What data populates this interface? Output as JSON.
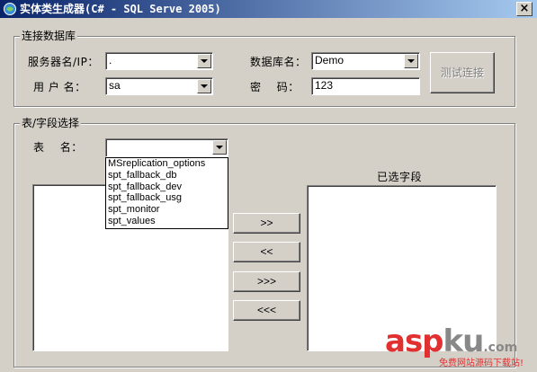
{
  "window": {
    "title": "实体类生成器(C# - SQL Serve 2005)",
    "close_glyph": "×"
  },
  "connect_group": {
    "title": "连接数据库",
    "server_label": "服务器名/IP：",
    "server_value": ".",
    "database_label": "数据库名：",
    "database_value": "Demo",
    "user_label": "用 户 名：",
    "user_value": "sa",
    "password_label": "密    码：",
    "password_value": "123",
    "test_button": "测试连接"
  },
  "select_group": {
    "title": "表/字段选择",
    "table_label": "表    名：",
    "table_value": "",
    "table_options": [
      "MSreplication_options",
      "spt_fallback_db",
      "spt_fallback_dev",
      "spt_fallback_usg",
      "spt_monitor",
      "spt_values"
    ],
    "selected_fields_label": "已选字段",
    "btn_add": ">>",
    "btn_remove": "<<",
    "btn_add_all": ">>>",
    "btn_remove_all": "<<<"
  },
  "watermark": {
    "brand_part1": "asp",
    "brand_part2": "ku",
    "brand_part3": ".com",
    "subtitle": "免费网站源码下载站!"
  },
  "colors": {
    "title_start": "#0a246a",
    "title_end": "#a6caf0",
    "window_bg": "#d4d0c8",
    "watermark_red": "#e03030"
  }
}
